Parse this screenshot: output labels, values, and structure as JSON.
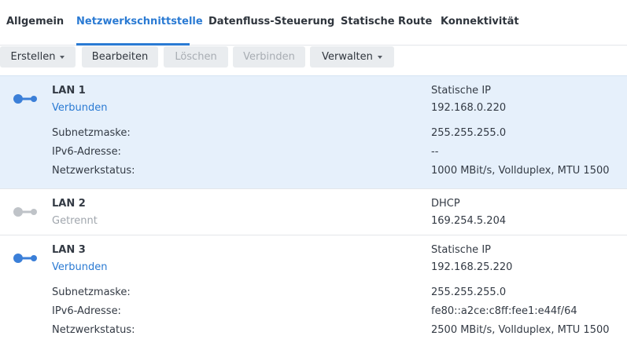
{
  "tabs": [
    {
      "label": "Allgemein"
    },
    {
      "label": "Netzwerkschnittstelle"
    },
    {
      "label": "Datenfluss-Steuerung"
    },
    {
      "label": "Statische Route"
    },
    {
      "label": "Konnektivität"
    }
  ],
  "active_tab": "Netzwerkschnittstelle",
  "toolbar": {
    "create": "Erstellen",
    "edit": "Bearbeiten",
    "delete": "Löschen",
    "connect": "Verbinden",
    "manage": "Verwalten"
  },
  "labels": {
    "subnet": "Subnetzmaske:",
    "ipv6": "IPv6-Adresse:",
    "status": "Netzwerkstatus:"
  },
  "colors": {
    "accent": "#2a7ad3",
    "selected_row": "#e6f0fb",
    "connected_icon": "#3b7fd8",
    "disconnected_icon": "#bfc3c8"
  },
  "interfaces": [
    {
      "name": "LAN 1",
      "state": "Verbunden",
      "connected": true,
      "ip_mode": "Statische IP",
      "ip": "192.168.0.220",
      "subnet": "255.255.255.0",
      "ipv6": "--",
      "net_status": "1000 MBit/s, Vollduplex, MTU 1500",
      "icon": "network-connected-icon"
    },
    {
      "name": "LAN 2",
      "state": "Getrennt",
      "connected": false,
      "ip_mode": "DHCP",
      "ip": "169.254.5.204",
      "icon": "network-disconnected-icon"
    },
    {
      "name": "LAN 3",
      "state": "Verbunden",
      "connected": true,
      "ip_mode": "Statische IP",
      "ip": "192.168.25.220",
      "subnet": "255.255.255.0",
      "ipv6": "fe80::a2ce:c8ff:fee1:e44f/64",
      "net_status": "2500 MBit/s, Vollduplex, MTU 1500",
      "icon": "network-connected-icon"
    }
  ]
}
